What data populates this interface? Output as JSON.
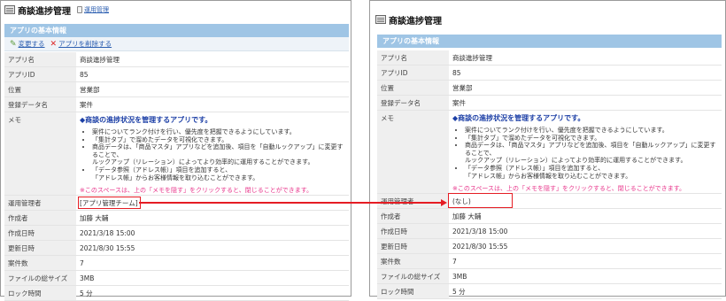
{
  "left": {
    "title": "商談進捗管理",
    "crumb": "運用管理",
    "section": "アプリの基本情報",
    "actions": {
      "edit": "変更する",
      "delete": "アプリを削除する"
    },
    "rows": [
      {
        "label": "アプリ名",
        "value": "商談進捗管理"
      },
      {
        "label": "アプリID",
        "value": "85"
      },
      {
        "label": "位置",
        "value": "営業部"
      },
      {
        "label": "登録データ名",
        "value": "案件"
      }
    ],
    "memo": {
      "label": "メモ",
      "title": "◆商談の進捗状況を管理するアプリです。",
      "items": [
        "案件についてランク付けを行い、優先度を把握できるようにしています。",
        "「集計タブ」で溜めたデータを可視化できます。",
        "商品データは、「商品マスタ」アプリなどを追加後、項目を「自動ルックアップ」に変更することで、",
        "ルックアップ（リレーション）によってより効率的に運用することができます。",
        "「データ参照（アドレス帳）」項目を追加すると、",
        "「アドレス帳」からお客様情報を取り込むことができます。"
      ],
      "note": "※このスペースは、上の「メモを隠す」をクリックすると、閉じることができます。"
    },
    "rows2": [
      {
        "label": "運用管理者",
        "value": "[アプリ管理チーム]"
      },
      {
        "label": "作成者",
        "value": "加藤 大輔"
      },
      {
        "label": "作成日時",
        "value": "2021/3/18 15:00"
      },
      {
        "label": "更新日時",
        "value": "2021/8/30 15:55"
      },
      {
        "label": "案件数",
        "value": "7"
      },
      {
        "label": "ファイルの総サイズ",
        "value": "3MB"
      },
      {
        "label": "ロック時間",
        "value": "5 分"
      }
    ]
  },
  "right": {
    "title": "商談進捗管理",
    "section": "アプリの基本情報",
    "rows": [
      {
        "label": "アプリ名",
        "value": "商談進捗管理"
      },
      {
        "label": "アプリID",
        "value": "85"
      },
      {
        "label": "位置",
        "value": "営業部"
      },
      {
        "label": "登録データ名",
        "value": "案件"
      }
    ],
    "memo": {
      "label": "メモ",
      "title": "◆商談の進捗状況を管理するアプリです。",
      "items": [
        "案件についてランク付けを行い、優先度を把握できるようにしています。",
        "「集計タブ」で溜めたデータを可視化できます。",
        "商品データは、「商品マスタ」アプリなどを追加後、項目を「自動ルックアップ」に変更することで、",
        "ルックアップ（リレーション）によってより効率的に運用することができます。",
        "「データ参照（アドレス帳）」項目を追加すると、",
        "「アドレス帳」からお客様情報を取り込むことができます。"
      ],
      "note": "※このスペースは、上の「メモを隠す」をクリックすると、閉じることができます。"
    },
    "rows2": [
      {
        "label": "運用管理者",
        "value": "(なし)"
      },
      {
        "label": "作成者",
        "value": "加藤 大輔"
      },
      {
        "label": "作成日時",
        "value": "2021/3/18 15:00"
      },
      {
        "label": "更新日時",
        "value": "2021/8/30 15:55"
      },
      {
        "label": "案件数",
        "value": "7"
      },
      {
        "label": "ファイルの総サイズ",
        "value": "3MB"
      },
      {
        "label": "ロック時間",
        "value": "5 分"
      }
    ]
  },
  "colors": {
    "highlight": "#e51c23",
    "header_blue": "#9fc5e5",
    "memo_title": "#1c3fa6",
    "memo_note": "#e8358b",
    "link": "#2a5db0"
  },
  "icons": [
    "app-icon",
    "document-icon",
    "pencil-icon",
    "delete-x-icon",
    "arrow-right-icon"
  ]
}
